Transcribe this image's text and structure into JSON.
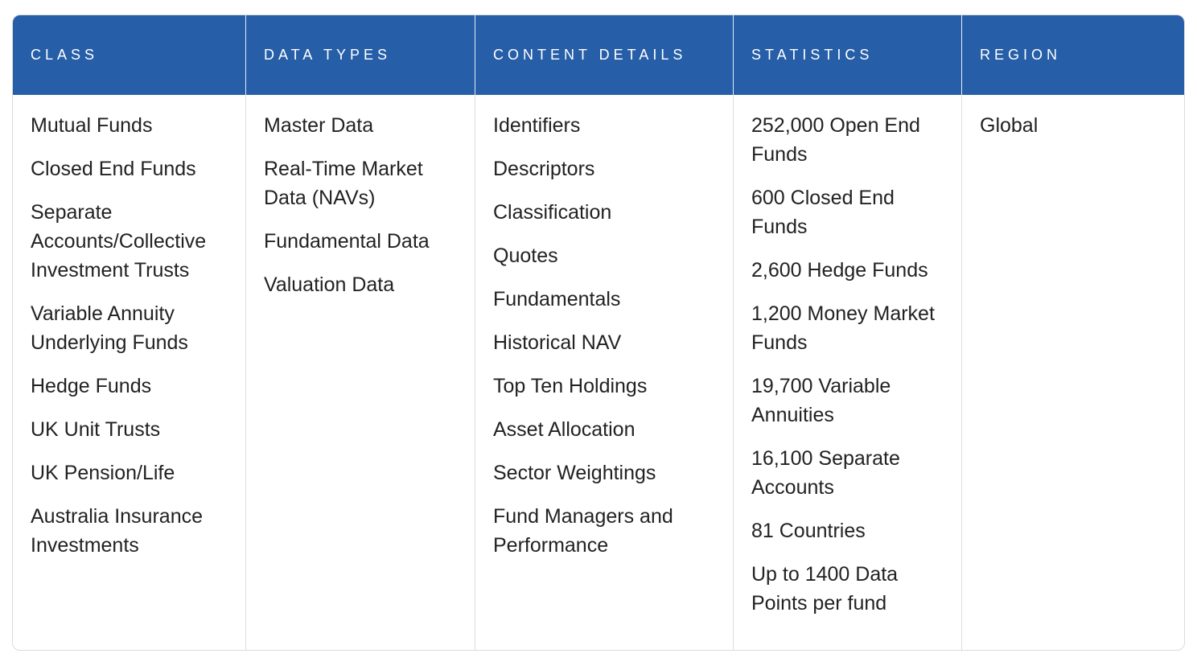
{
  "table": {
    "header_color": "#265ea8",
    "columns": [
      {
        "header": "CLASS",
        "items": [
          "Mutual Funds",
          "Closed End Funds",
          "Separate Accounts/Collective Investment Trusts",
          "Variable Annuity Underlying Funds",
          "Hedge Funds",
          "UK Unit Trusts",
          "UK Pension/Life",
          "Australia Insurance Investments"
        ]
      },
      {
        "header": "DATA TYPES",
        "items": [
          "Master Data",
          "Real-Time Market Data (NAVs)",
          "Fundamental Data",
          "Valuation Data"
        ]
      },
      {
        "header": "CONTENT DETAILS",
        "items": [
          "Identifiers",
          "Descriptors",
          "Classification",
          "Quotes",
          "Fundamentals",
          "Historical NAV",
          "Top Ten Holdings",
          "Asset Allocation",
          "Sector Weightings",
          "Fund Managers and Performance"
        ]
      },
      {
        "header": "STATISTICS",
        "items": [
          "252,000 Open End Funds",
          "600 Closed End Funds",
          "2,600 Hedge Funds",
          "1,200 Money Market Funds",
          "19,700 Variable Annuities",
          "16,100 Separate Accounts",
          "81 Countries",
          "Up to 1400 Data Points per fund"
        ]
      },
      {
        "header": "REGION",
        "items": [
          "Global"
        ]
      }
    ]
  }
}
